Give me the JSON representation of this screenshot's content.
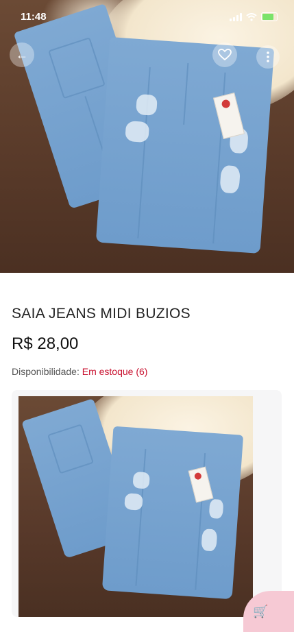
{
  "status_bar": {
    "time": "11:48"
  },
  "product": {
    "title": "SAIA JEANS MIDI BUZIOS",
    "price": "R$ 28,00",
    "availability_label": "Disponibilidade:",
    "availability_value": "Em estoque",
    "stock_count": "(6)"
  },
  "icons": {
    "back": "back-icon",
    "favorite": "heart-icon",
    "more": "more-vertical-icon",
    "cart": "cart-icon"
  },
  "colors": {
    "accent": "#c8102e",
    "fab": "#f6c9d4"
  }
}
